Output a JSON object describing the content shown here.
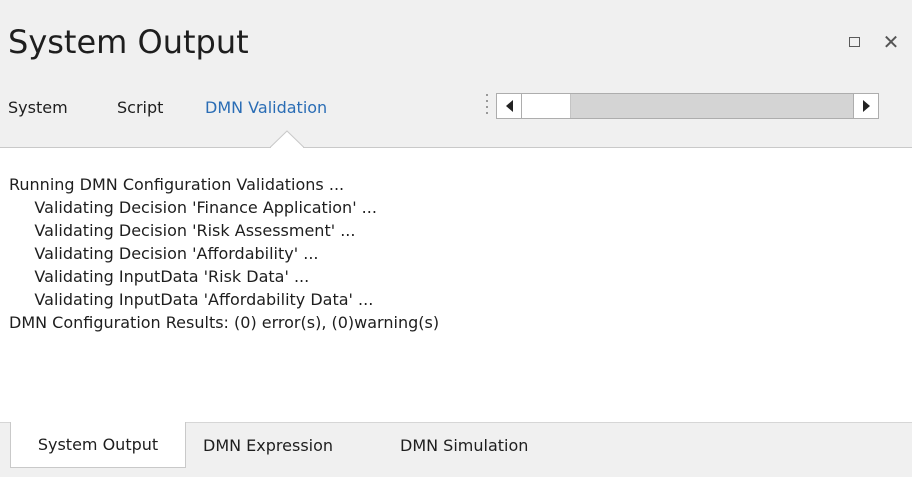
{
  "window": {
    "title": "System Output",
    "maximize_icon": "maximize-icon",
    "close_icon": "close-icon",
    "close_glyph": "✕"
  },
  "tabs": [
    {
      "label": "System"
    },
    {
      "label": "Script"
    },
    {
      "label": "DMN Validation",
      "active": true
    }
  ],
  "scrollbar": {
    "left_icon": "arrow-left-icon",
    "right_icon": "arrow-right-icon"
  },
  "output": {
    "lines": [
      "Running DMN Configuration Validations ...",
      "     Validating Decision 'Finance Application' ...",
      "     Validating Decision 'Risk Assessment' ...",
      "     Validating Decision 'Affordability' ...",
      "     Validating InputData 'Risk Data' ...",
      "     Validating InputData 'Affordability Data' ...",
      "DMN Configuration Results: (0) error(s), (0)warning(s)"
    ]
  },
  "bottom_tabs": [
    {
      "label": "System Output",
      "active": true
    },
    {
      "label": "DMN Expression"
    },
    {
      "label": "DMN Simulation"
    }
  ],
  "colors": {
    "active_tab": "#2a6db5",
    "background": "#f0f0f0",
    "content": "#ffffff"
  }
}
